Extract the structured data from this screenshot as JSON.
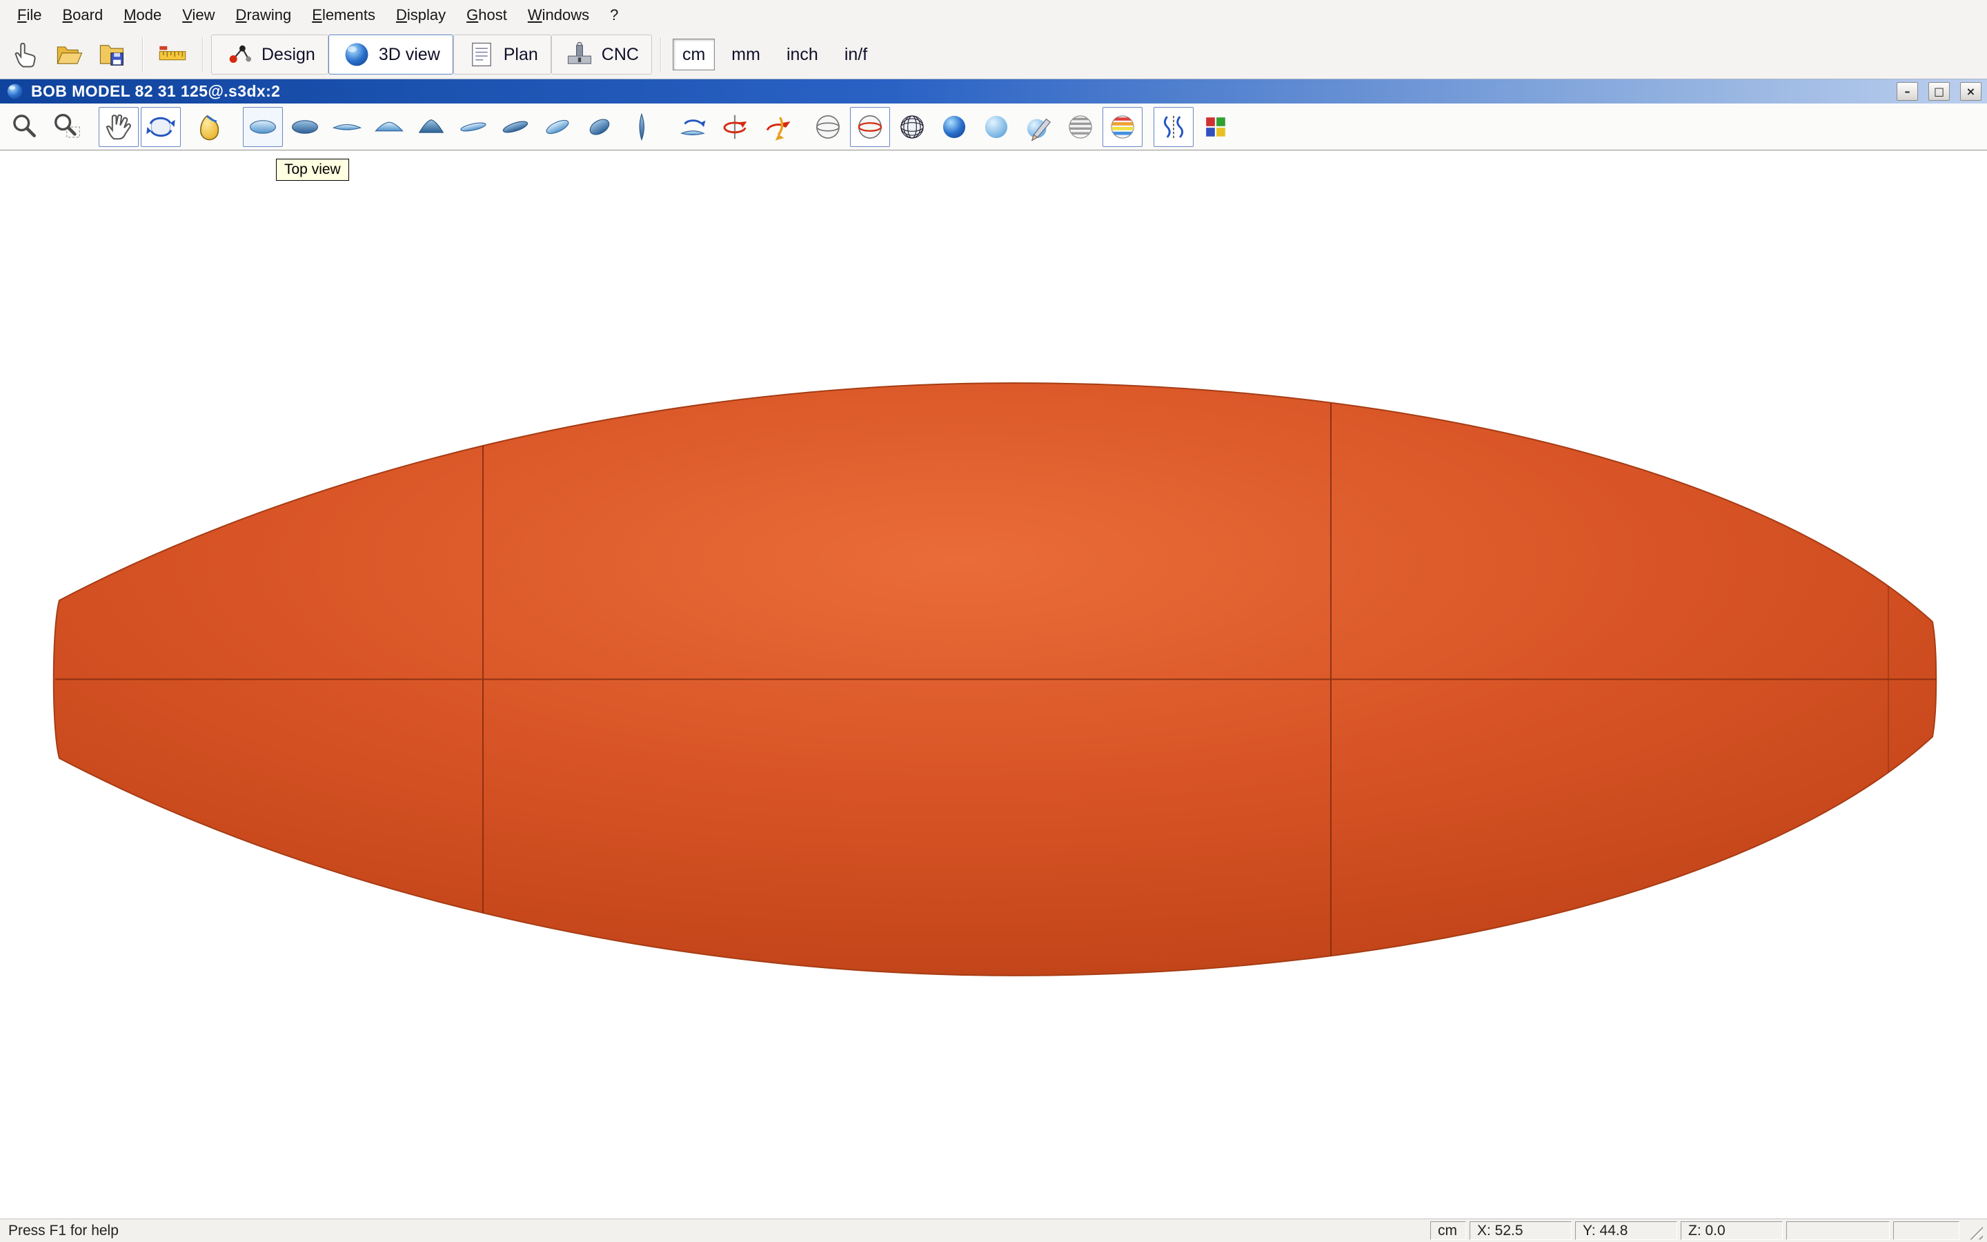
{
  "window": {
    "title": "BOB MODEL 82 31 125@.s3dx:2",
    "controls": {
      "minimize": "–",
      "maximize": "□",
      "close": "×"
    }
  },
  "menu": {
    "items": [
      "File",
      "Board",
      "Mode",
      "View",
      "Drawing",
      "Elements",
      "Display",
      "Ghost",
      "Windows",
      "?"
    ]
  },
  "toolbar": {
    "design_label": "Design",
    "view3d_label": "3D view",
    "plan_label": "Plan",
    "cnc_label": "CNC",
    "unit_cm": "cm",
    "unit_mm": "mm",
    "unit_inch": "inch",
    "unit_inf": "in/f",
    "selected_unit": "cm",
    "selected_mode": "3D view"
  },
  "view_toolbar": {
    "tooltip": "Top view",
    "icons": [
      "zoom-icon",
      "zoom-window-icon",
      "pan-icon",
      "rotate-3d-icon",
      "light-icon",
      "top-view-icon",
      "bottom-view-icon",
      "outline-view-icon",
      "front-view-icon",
      "back-view-icon",
      "perspective-1-icon",
      "perspective-2-icon",
      "perspective-3-icon",
      "perspective-4-icon",
      "perspective-5-icon",
      "flip-board-icon",
      "rotate-y-icon",
      "rotate-x-icon",
      "wireframe-sphere-icon",
      "wireframe-red-sphere-icon",
      "mesh-sphere-icon",
      "shaded-sphere-icon",
      "smooth-sphere-icon",
      "paint-sphere-icon",
      "striped-sphere-icon",
      "color-striped-sphere-icon",
      "curvature-icon",
      "color-squares-icon"
    ]
  },
  "statusbar": {
    "help": "Press F1 for help",
    "unit": "cm",
    "x": "X: 52.5",
    "y": "Y: 44.8",
    "z": "Z: 0.0"
  },
  "board": {
    "colors": {
      "highlight": "#ea6c38",
      "mid": "#d85426",
      "dark": "#c6471b",
      "edge": "#b23d14",
      "line": "#7a2a0e"
    }
  }
}
